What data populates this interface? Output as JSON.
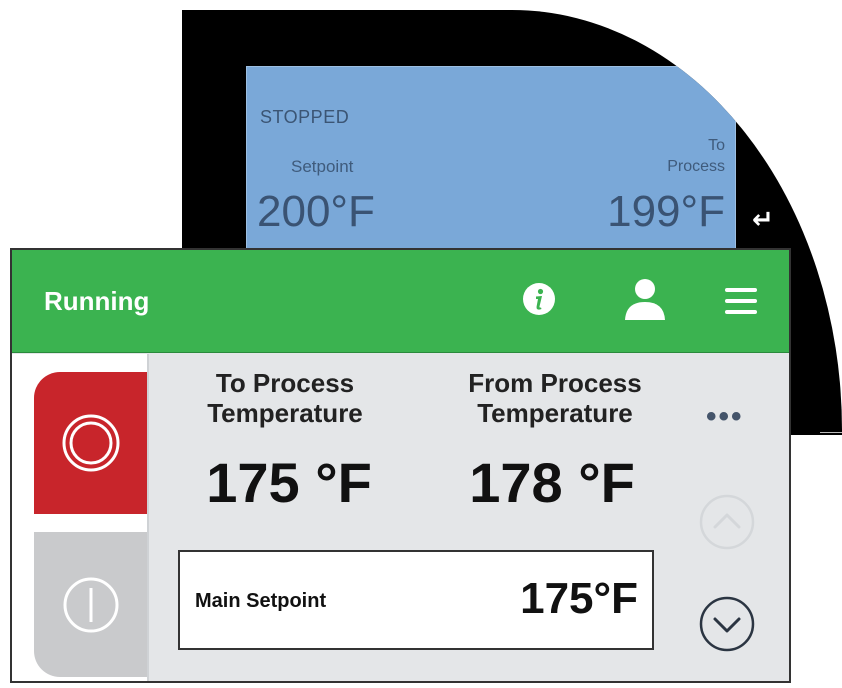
{
  "legacy_display": {
    "status": "STOPPED",
    "setpoint_label": "Setpoint",
    "to_process_label_1": "To",
    "to_process_label_2": "Process",
    "setpoint_value": "200°F",
    "to_process_value": "199°F",
    "up_button": "↑",
    "enter_button": "↵"
  },
  "hmi": {
    "header": {
      "status_title": "Running",
      "icons": [
        "info-icon",
        "user-icon",
        "menu-icon"
      ]
    },
    "controls": {
      "stop_icon": "stop-icon",
      "start_icon": "power-icon"
    },
    "readings": {
      "to_process_label_1": "To Process",
      "to_process_label_2": "Temperature",
      "to_process_value": "175 °F",
      "from_process_label_1": "From Process",
      "from_process_label_2": "Temperature",
      "from_process_value": "178 °F"
    },
    "setpoint": {
      "label": "Main Setpoint",
      "value": "175°F"
    },
    "more": "•••"
  },
  "colors": {
    "header_green": "#3bb350",
    "stop_red": "#c8252b",
    "legacy_screen_blue": "#7aa8d8"
  }
}
